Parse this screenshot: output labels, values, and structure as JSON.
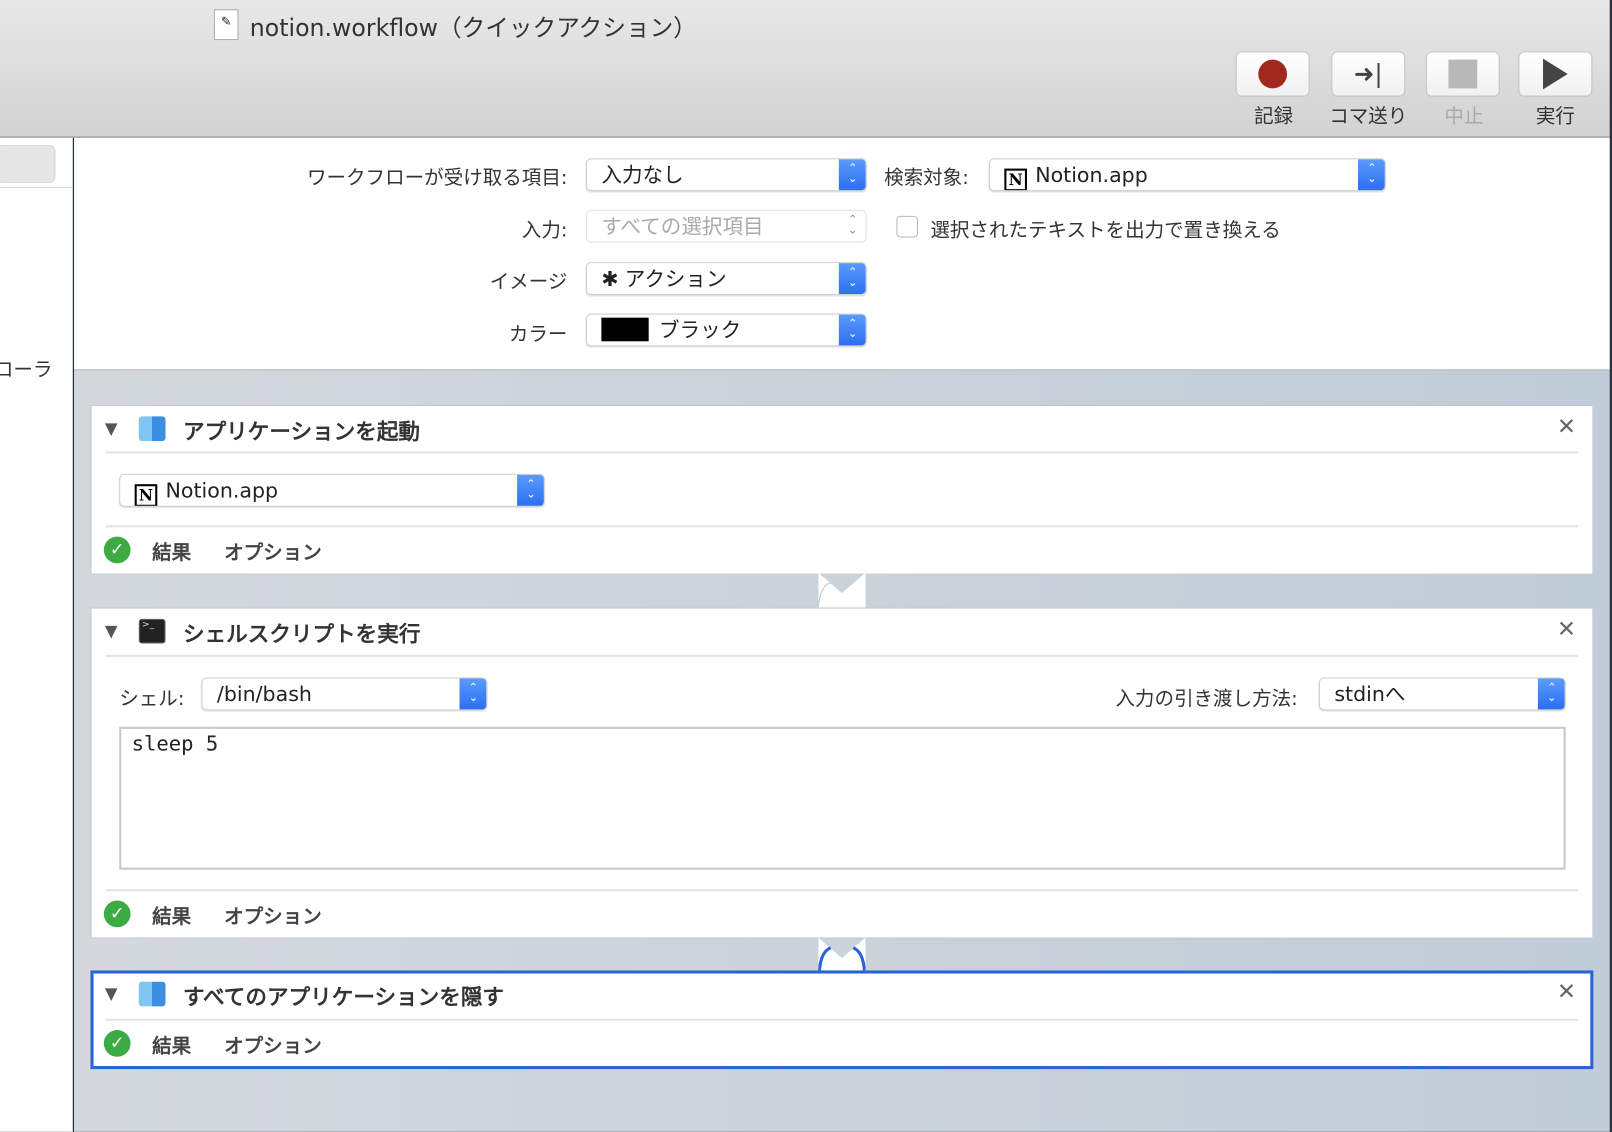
{
  "window": {
    "title": "notion.workflow（クイックアクション）"
  },
  "toolbar": {
    "buttons": [
      {
        "label": "記録",
        "icon": "record-icon",
        "color": "#a0281e"
      },
      {
        "label": "コマ送り",
        "icon": "step-icon"
      },
      {
        "label": "中止",
        "icon": "stop-icon",
        "disabled": true
      },
      {
        "label": "実行",
        "icon": "play-icon"
      }
    ]
  },
  "sidebar": {
    "partial_text": "ローラ"
  },
  "settings": {
    "receives_label": "ワークフローが受け取る項目:",
    "receives_value": "入力なし",
    "search_label": "検索対象:",
    "search_value": "Notion.app",
    "input_label": "入力:",
    "input_value": "すべての選択項目",
    "replace_label": "選択されたテキストを出力で置き換える",
    "image_label": "イメージ",
    "image_value": "アクション",
    "color_label": "カラー",
    "color_value": "ブラック",
    "color_swatch": "#000000"
  },
  "actions": [
    {
      "title": "アプリケーションを起動",
      "app": "Notion.app",
      "results": "結果",
      "options": "オプション"
    },
    {
      "title": "シェルスクリプトを実行",
      "shell_label": "シェル:",
      "shell": "/bin/bash",
      "pass_label": "入力の引き渡し方法:",
      "pass": "stdinへ",
      "script": "sleep 5",
      "results": "結果",
      "options": "オプション"
    },
    {
      "title": "すべてのアプリケーションを隠す",
      "results": "結果",
      "options": "オプション"
    }
  ],
  "accent": "#2a62d8"
}
